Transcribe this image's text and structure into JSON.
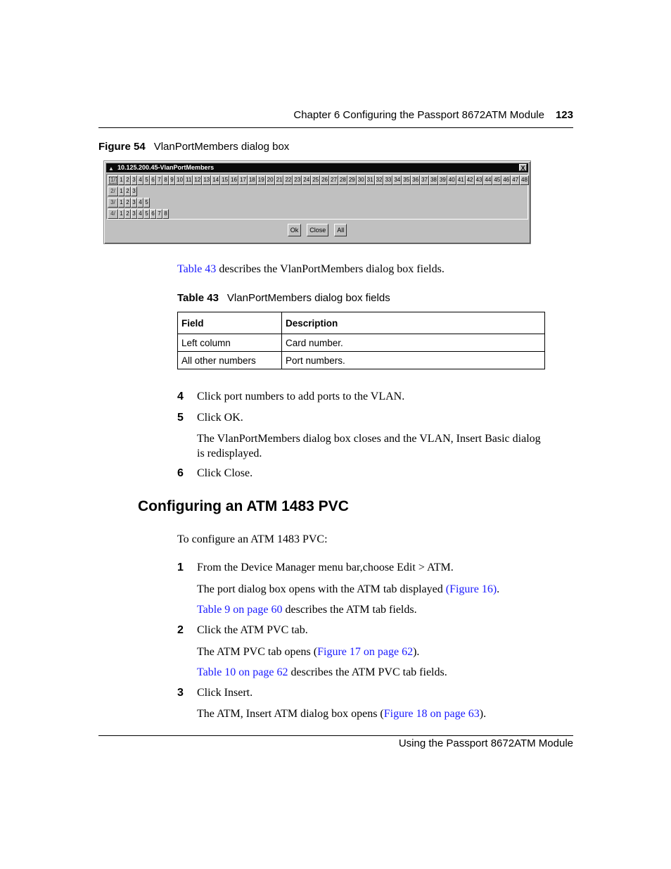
{
  "header": {
    "chapter_text": "Chapter 6  Configuring the Passport 8672ATM Module",
    "page_number": "123"
  },
  "figure": {
    "label": "Figure 54",
    "title": "VlanPortMembers dialog box"
  },
  "dialog": {
    "title": "10.125.200.45-VlanPortMembers",
    "title_icon": "device-manager-icon",
    "close_label": "X",
    "rows": [
      {
        "card": "1/",
        "ports": [
          "1",
          "2",
          "3",
          "4",
          "5",
          "6",
          "7",
          "8",
          "9",
          "10",
          "11",
          "12",
          "13",
          "14",
          "15",
          "16",
          "17",
          "18",
          "19",
          "20",
          "21",
          "22",
          "23",
          "24",
          "25",
          "26",
          "27",
          "28",
          "29",
          "30",
          "31",
          "32",
          "33",
          "34",
          "35",
          "36",
          "37",
          "38",
          "39",
          "40",
          "41",
          "42",
          "43",
          "44",
          "45",
          "46",
          "47",
          "48"
        ]
      },
      {
        "card": "2/",
        "ports": [
          "1",
          "2",
          "3"
        ]
      },
      {
        "card": "3/",
        "ports": [
          "1",
          "2",
          "3",
          "4",
          "5"
        ]
      },
      {
        "card": "4/",
        "ports": [
          "1",
          "2",
          "3",
          "4",
          "5",
          "6",
          "7",
          "8"
        ]
      }
    ],
    "buttons": {
      "ok": "Ok",
      "close": "Close",
      "all": "All"
    }
  },
  "intro": {
    "link": "Table 43",
    "text": " describes the VlanPortMembers dialog box fields."
  },
  "table": {
    "label": "Table 43",
    "title": "VlanPortMembers dialog box fields",
    "headers": [
      "Field",
      "Description"
    ],
    "rows": [
      [
        "Left column",
        "Card number."
      ],
      [
        "All other numbers",
        "Port numbers."
      ]
    ]
  },
  "steps_a": [
    {
      "num": "4",
      "text": "Click port numbers to add ports to the VLAN."
    },
    {
      "num": "5",
      "text": "Click OK."
    },
    {
      "num": "6",
      "text": "Click Close."
    }
  ],
  "step5_result": {
    "line1": "The VlanPortMembers dialog box closes and the VLAN, Insert Basic dialog",
    "line2": "is redisplayed."
  },
  "section": {
    "heading": "Configuring an ATM 1483 PVC",
    "intro": "To configure an ATM 1483 PVC:"
  },
  "steps_b": {
    "s1": {
      "num": "1",
      "text": "From the Device Manager menu bar,choose Edit > ATM."
    },
    "s1_r1": {
      "pre": "The port dialog box opens with the ATM tab displayed ",
      "link": "(Figure 16)",
      "post": "."
    },
    "s1_r2": {
      "link": "Table 9 on page 60",
      "post": " describes the ATM tab fields."
    },
    "s2": {
      "num": "2",
      "text": "Click the ATM PVC tab."
    },
    "s2_r1": {
      "pre": "The ATM PVC tab opens (",
      "link": "Figure 17 on page 62",
      "post": ")."
    },
    "s2_r2": {
      "link": "Table 10 on page 62",
      "post": " describes the ATM PVC tab fields."
    },
    "s3": {
      "num": "3",
      "text": "Click Insert."
    },
    "s3_r1": {
      "pre": "The ATM, Insert ATM dialog box opens (",
      "link": "Figure 18 on page 63",
      "post": ")."
    }
  },
  "footer": {
    "text": "Using the Passport 8672ATM Module"
  },
  "colors": {
    "link": "#1a1aff",
    "dialog_face": "#c0c0c0",
    "titlebar": "#0a0a0a"
  }
}
